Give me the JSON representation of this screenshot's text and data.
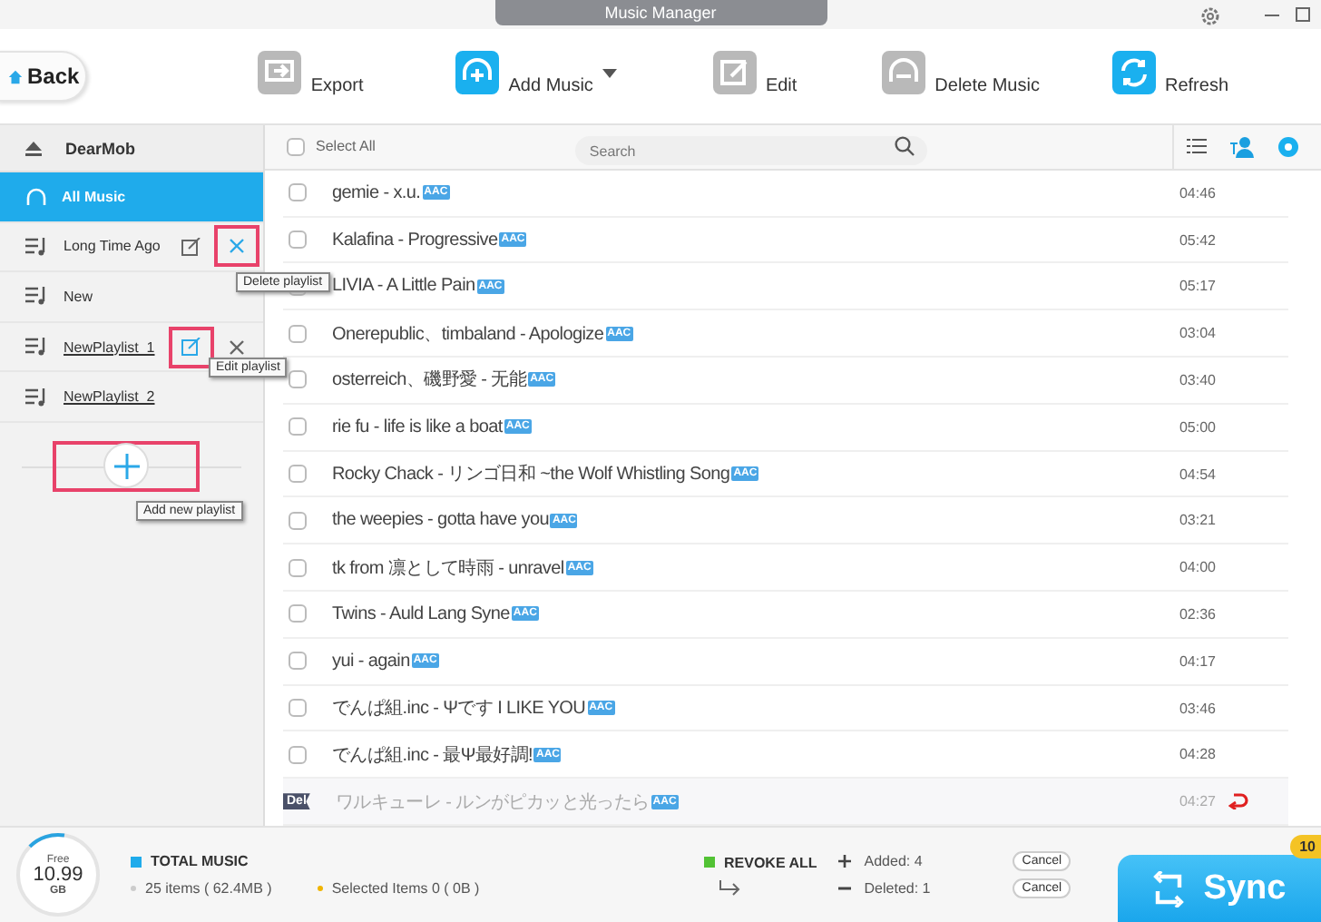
{
  "window": {
    "title": "Music Manager"
  },
  "toolbar": {
    "back": "Back",
    "buttons": [
      {
        "kind": "export",
        "label": "Export"
      },
      {
        "kind": "add",
        "label": "Add Music",
        "dropdown": true
      },
      {
        "kind": "edit",
        "label": "Edit"
      },
      {
        "kind": "delete",
        "label": "Delete Music"
      },
      {
        "kind": "refresh",
        "label": "Refresh"
      }
    ]
  },
  "sidebar": {
    "device": "DearMob",
    "items": [
      {
        "kind": "all",
        "label": "All Music",
        "selected": true,
        "new": false
      },
      {
        "kind": "playlist",
        "label": "Long Time  Ago",
        "selected": false,
        "new": false,
        "actions_shown": true,
        "edit_highlighted": false,
        "delete_highlighted": true,
        "tooltip": "Delete playlist"
      },
      {
        "kind": "playlist",
        "label": "New",
        "selected": false,
        "new": false
      },
      {
        "kind": "playlist",
        "label": "NewPlaylist_1",
        "selected": false,
        "new": true,
        "actions_shown": true,
        "edit_highlighted": true,
        "delete_highlighted": false,
        "tooltip": "Edit playlist"
      },
      {
        "kind": "playlist",
        "label": "NewPlaylist_2",
        "selected": false,
        "new": true
      }
    ],
    "add_tooltip": "Add new playlist"
  },
  "list": {
    "select_all": "Select All",
    "select_all_checked": false,
    "search": {
      "placeholder": "Search"
    },
    "rows": [
      {
        "title": "gemie - x.u.",
        "format": "AAC",
        "time": "04:46",
        "deleted": false
      },
      {
        "title": "Kalafina - Progressive",
        "format": "AAC",
        "time": "05:42",
        "deleted": false
      },
      {
        "title": "LIVIA - A Little Pain",
        "format": "AAC",
        "time": "05:17",
        "deleted": false
      },
      {
        "title": "Onerepublic、timbaland - Apologize",
        "format": "AAC",
        "time": "03:04",
        "deleted": false
      },
      {
        "title": "osterreich、磯野愛 - 无能",
        "format": "AAC",
        "time": "03:40",
        "deleted": false
      },
      {
        "title": "rie fu - life is like a boat",
        "format": "AAC",
        "time": "05:00",
        "deleted": false
      },
      {
        "title": "Rocky Chack - リンゴ日和 ~the Wolf Whistling Song",
        "format": "AAC",
        "time": "04:54",
        "deleted": false
      },
      {
        "title": "the weepies - gotta have you",
        "format": "AAC",
        "time": "03:21",
        "deleted": false
      },
      {
        "title": "tk from 凛として時雨 - unravel",
        "format": "AAC",
        "time": "04:00",
        "deleted": false
      },
      {
        "title": "Twins - Auld Lang Syne",
        "format": "AAC",
        "time": "02:36",
        "deleted": false
      },
      {
        "title": "yui - again",
        "format": "AAC",
        "time": "04:17",
        "deleted": false
      },
      {
        "title": "でんぱ組.inc - Ψです I LIKE YOU",
        "format": "AAC",
        "time": "03:46",
        "deleted": false
      },
      {
        "title": "でんぱ組.inc - 最Ψ最好調!",
        "format": "AAC",
        "time": "04:28",
        "deleted": false
      },
      {
        "title": "ワルキューレ - ルンがピカッと光ったら",
        "format": "AAC",
        "time": "04:27",
        "deleted": true,
        "del_badge": "Del"
      }
    ]
  },
  "footer": {
    "storage": {
      "label": "Free",
      "value": "10.99",
      "unit": "GB",
      "level": 0.15
    },
    "total_title": "TOTAL MUSIC",
    "items": "25 items ( 62.4MB )",
    "selected": "Selected Items 0 ( 0B )",
    "revoke": "REVOKE ALL",
    "added": "Added: 4",
    "deleted": "Deleted: 1",
    "cancel_labels": [
      "Cancel",
      "Cancel"
    ],
    "sync": "Sync",
    "badge": "10"
  }
}
